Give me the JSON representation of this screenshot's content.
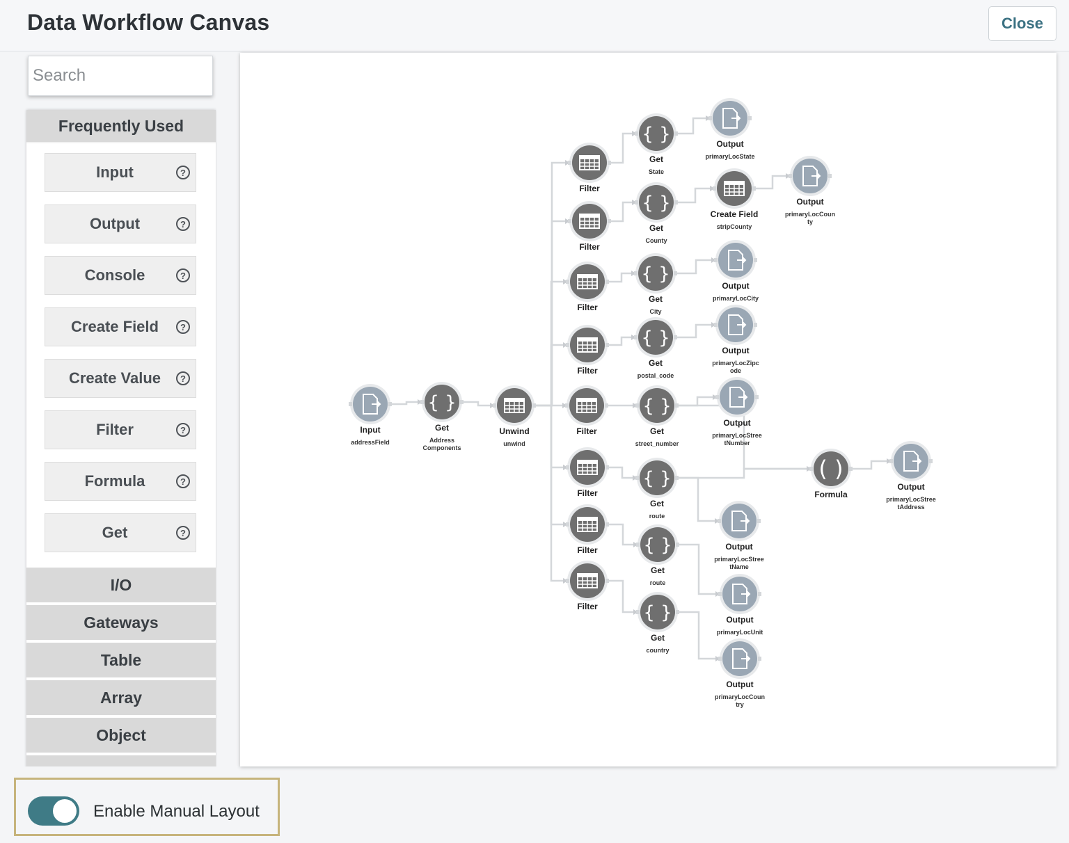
{
  "header": {
    "title": "Data Workflow Canvas",
    "close_label": "Close"
  },
  "sidebar": {
    "search_placeholder": "Search",
    "frequently_used_label": "Frequently Used",
    "items": [
      {
        "label": "Input"
      },
      {
        "label": "Output"
      },
      {
        "label": "Console"
      },
      {
        "label": "Create Field"
      },
      {
        "label": "Create Value"
      },
      {
        "label": "Filter"
      },
      {
        "label": "Formula"
      },
      {
        "label": "Get"
      }
    ],
    "help_glyph": "?",
    "categories": [
      "I/O",
      "Gateways",
      "Table",
      "Array",
      "Object"
    ]
  },
  "footer": {
    "toggle_label": "Enable Manual Layout",
    "toggle_on": true
  },
  "icons": {
    "input": "file-import-icon",
    "output": "file-export-icon",
    "get": "braces-icon",
    "filter": "table-icon",
    "formula": "parentheses-icon",
    "help": "question-circle-icon"
  },
  "colors": {
    "accent": "#3f7b86",
    "node_dark": "#6f6f6f",
    "node_light": "#9aa7b4",
    "highlight_border": "#c6b47c"
  },
  "workflow": {
    "nodes": [
      {
        "id": "n_input",
        "type": "input",
        "title": "Input",
        "sub": [
          "addressField"
        ]
      },
      {
        "id": "n_get_addr",
        "type": "get",
        "title": "Get",
        "sub": [
          "Address",
          "Components"
        ]
      },
      {
        "id": "n_unwind",
        "type": "filter",
        "title": "Unwind",
        "sub": [
          "unwind"
        ]
      },
      {
        "id": "f1",
        "type": "filter",
        "title": "Filter",
        "sub": []
      },
      {
        "id": "f2",
        "type": "filter",
        "title": "Filter",
        "sub": []
      },
      {
        "id": "f3",
        "type": "filter",
        "title": "Filter",
        "sub": []
      },
      {
        "id": "f4",
        "type": "filter",
        "title": "Filter",
        "sub": []
      },
      {
        "id": "f5",
        "type": "filter",
        "title": "Filter",
        "sub": []
      },
      {
        "id": "f6",
        "type": "filter",
        "title": "Filter",
        "sub": []
      },
      {
        "id": "f7",
        "type": "filter",
        "title": "Filter",
        "sub": []
      },
      {
        "id": "f8",
        "type": "filter",
        "title": "Filter",
        "sub": []
      },
      {
        "id": "g1",
        "type": "get",
        "title": "Get",
        "sub": [
          "State"
        ]
      },
      {
        "id": "g2",
        "type": "get",
        "title": "Get",
        "sub": [
          "County"
        ]
      },
      {
        "id": "g3",
        "type": "get",
        "title": "Get",
        "sub": [
          "City"
        ]
      },
      {
        "id": "g4",
        "type": "get",
        "title": "Get",
        "sub": [
          "postal_code"
        ]
      },
      {
        "id": "g5",
        "type": "get",
        "title": "Get",
        "sub": [
          "street_number"
        ]
      },
      {
        "id": "g6",
        "type": "get",
        "title": "Get",
        "sub": [
          "route"
        ]
      },
      {
        "id": "g7",
        "type": "get",
        "title": "Get",
        "sub": [
          "route"
        ]
      },
      {
        "id": "g8",
        "type": "get",
        "title": "Get",
        "sub": [
          "country"
        ]
      },
      {
        "id": "cf",
        "type": "filter",
        "title": "Create Field",
        "sub": [
          "stripCounty"
        ]
      },
      {
        "id": "fx",
        "type": "formula",
        "title": "Formula",
        "sub": []
      },
      {
        "id": "o_state",
        "type": "output",
        "title": "Output",
        "sub": [
          "primaryLocState"
        ]
      },
      {
        "id": "o_county",
        "type": "output",
        "title": "Output",
        "sub": [
          "primaryLocCoun",
          "ty"
        ]
      },
      {
        "id": "o_city",
        "type": "output",
        "title": "Output",
        "sub": [
          "primaryLocCity"
        ]
      },
      {
        "id": "o_zip",
        "type": "output",
        "title": "Output",
        "sub": [
          "primaryLocZipc",
          "ode"
        ]
      },
      {
        "id": "o_stnum",
        "type": "output",
        "title": "Output",
        "sub": [
          "primaryLocStree",
          "tNumber"
        ]
      },
      {
        "id": "o_addr",
        "type": "output",
        "title": "Output",
        "sub": [
          "primaryLocStree",
          "tAddress"
        ]
      },
      {
        "id": "o_stname",
        "type": "output",
        "title": "Output",
        "sub": [
          "primaryLocStree",
          "tName"
        ]
      },
      {
        "id": "o_unit",
        "type": "output",
        "title": "Output",
        "sub": [
          "primaryLocUnit"
        ]
      },
      {
        "id": "o_country",
        "type": "output",
        "title": "Output",
        "sub": [
          "primaryLocCoun",
          "try"
        ]
      }
    ],
    "edges": [
      [
        "n_input",
        "n_get_addr"
      ],
      [
        "n_get_addr",
        "n_unwind"
      ],
      [
        "n_unwind",
        "f1"
      ],
      [
        "n_unwind",
        "f2"
      ],
      [
        "n_unwind",
        "f3"
      ],
      [
        "n_unwind",
        "f4"
      ],
      [
        "n_unwind",
        "f5"
      ],
      [
        "n_unwind",
        "f6"
      ],
      [
        "n_unwind",
        "f7"
      ],
      [
        "n_unwind",
        "f8"
      ],
      [
        "f1",
        "g1"
      ],
      [
        "f2",
        "g2"
      ],
      [
        "f3",
        "g3"
      ],
      [
        "f4",
        "g4"
      ],
      [
        "f5",
        "g5"
      ],
      [
        "f6",
        "g6"
      ],
      [
        "f7",
        "g7"
      ],
      [
        "f8",
        "g8"
      ],
      [
        "g1",
        "o_state"
      ],
      [
        "g2",
        "cf"
      ],
      [
        "cf",
        "o_county"
      ],
      [
        "g3",
        "o_city"
      ],
      [
        "g4",
        "o_zip"
      ],
      [
        "g5",
        "o_stnum"
      ],
      [
        "g5",
        "fx"
      ],
      [
        "g6",
        "fx"
      ],
      [
        "g6",
        "o_stname"
      ],
      [
        "fx",
        "o_addr"
      ],
      [
        "g7",
        "o_unit"
      ],
      [
        "g8",
        "o_country"
      ]
    ]
  }
}
